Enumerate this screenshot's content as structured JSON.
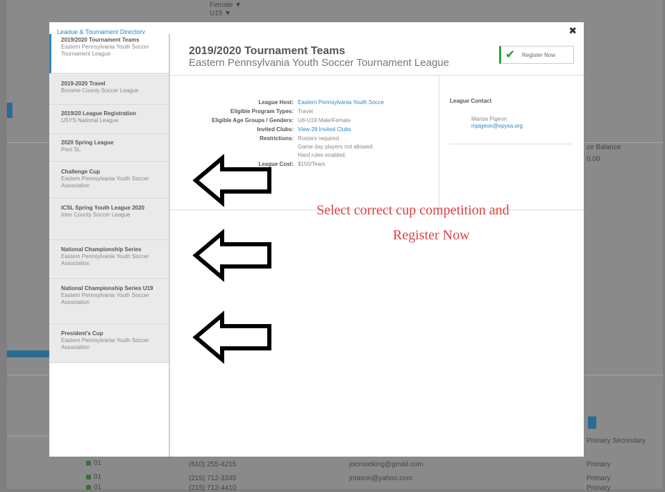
{
  "background": {
    "top_labels": [
      "Female ▼",
      "U15 ▼"
    ],
    "right_header": "ce Balance",
    "right_value": "0.00",
    "right_col_header": "Primary Secondary",
    "right_col_values": [
      "Primary",
      "Primary",
      "Primary"
    ],
    "phones": [
      "(610) 255-4215",
      "(215) 712-3345",
      "(215) 712-4410"
    ],
    "emails": [
      "joemoeking@gmail.com",
      "jmason@yahoo.com",
      ""
    ],
    "row_checks": [
      "01",
      "01",
      "01"
    ]
  },
  "modal": {
    "title": "League & Tournament Directory",
    "close": "✖"
  },
  "sidebar": {
    "items": [
      {
        "title": "2019/2020 Tournament Teams",
        "subtitle": "Eastern Pennsylvania Youth Soccer Tournament League"
      },
      {
        "title": "2019-2020 Travel",
        "subtitle": "Broome County Soccer League"
      },
      {
        "title": "2019/20 League Registration",
        "subtitle": "USYS National League"
      },
      {
        "title": "2020 Spring League",
        "subtitle": "Pool SL"
      },
      {
        "title": "Challenge Cup",
        "subtitle": "Eastern Pennsylvania Youth Soccer Association"
      },
      {
        "title": "ICSL Spring Youth League 2020",
        "subtitle": "Inter County Soccer League"
      },
      {
        "title": "National Championship Series",
        "subtitle": "Eastern Pennsylvania Youth Soccer Association"
      },
      {
        "title": "National Championship Series U19",
        "subtitle": "Eastern Pennsylvania Youth Soccer Association"
      },
      {
        "title": "President's Cup",
        "subtitle": "Eastern Pennsylvania Youth Soccer Association"
      }
    ]
  },
  "content": {
    "title": "2019/2020 Tournament Teams",
    "subtitle": "Eastern Pennsylvania Youth Soccer Tournament League",
    "register_label": "Register Now",
    "register_icon": "checkmark-icon",
    "details": {
      "league_host_label": "League Host:",
      "league_host_value": "Eastern Pennsylvania Youth Socce",
      "program_types_label": "Eligible Program Types:",
      "program_types_value": "Travel",
      "age_groups_label": "Eligible Age Groups / Genders:",
      "age_groups_value": "U8-U19 Male/Female",
      "invited_clubs_label": "Invited Clubs:",
      "invited_clubs_value": "View 28 Invited Clubs",
      "restrictions_label": "Restrictions:",
      "restrictions_values": [
        "Rosters required.",
        "Game day players not allowed.",
        "Hard rules enabled."
      ],
      "league_cost_label": "League Cost:",
      "league_cost_value": "$150/Team"
    },
    "league_contact": {
      "header": "League Contact",
      "name": "Marisa Pigeon",
      "email": "mpigeon@epysa.org"
    }
  },
  "annotation": {
    "line1": "Select correct cup competition and",
    "line2": "Register Now",
    "color": "#e04242"
  }
}
